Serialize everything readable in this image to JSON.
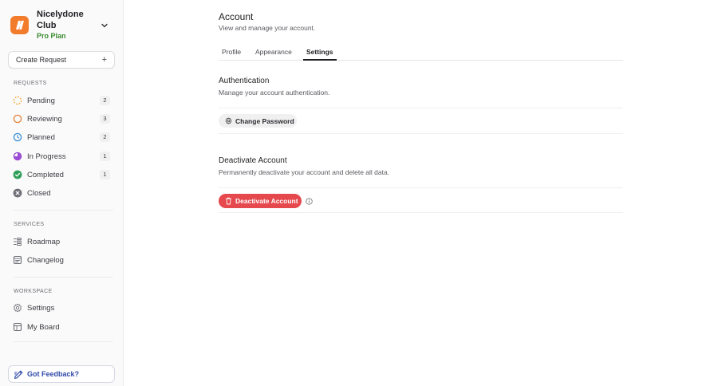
{
  "org": {
    "name": "Nicelydone Club",
    "plan": "Pro Plan"
  },
  "sidebar": {
    "create_label": "Create Request",
    "sections": {
      "requests": "REQUESTS",
      "services": "SERVICES",
      "workspace": "WORKSPACE"
    },
    "requests": [
      {
        "label": "Pending",
        "count": "2",
        "icon": "pending-dashed-circle-icon",
        "color": "#f2a93b"
      },
      {
        "label": "Reviewing",
        "count": "3",
        "icon": "reviewing-circle-icon",
        "color": "#e8833a"
      },
      {
        "label": "Planned",
        "count": "2",
        "icon": "planned-clock-icon",
        "color": "#3b8fd9"
      },
      {
        "label": "In Progress",
        "count": "1",
        "icon": "in-progress-icon",
        "color": "#9b4bd6"
      },
      {
        "label": "Completed",
        "count": "1",
        "icon": "completed-check-icon",
        "color": "#2f9e58"
      },
      {
        "label": "Closed",
        "icon": "closed-x-icon",
        "color": "#6f7077"
      }
    ],
    "services": [
      {
        "label": "Roadmap",
        "icon": "roadmap-icon"
      },
      {
        "label": "Changelog",
        "icon": "changelog-icon"
      }
    ],
    "workspace": [
      {
        "label": "Settings",
        "icon": "gear-icon"
      },
      {
        "label": "My Board",
        "icon": "board-icon"
      }
    ],
    "feedback_label": "Got Feedback?"
  },
  "main": {
    "title": "Account",
    "subtitle": "View and manage your account.",
    "tabs": [
      {
        "label": "Profile",
        "active": false
      },
      {
        "label": "Appearance",
        "active": false
      },
      {
        "label": "Settings",
        "active": true
      }
    ],
    "authentication": {
      "title": "Authentication",
      "description": "Manage your account authentication.",
      "button_label": "Change Password"
    },
    "deactivate": {
      "title": "Deactivate Account",
      "description": "Permanently deactivate your account and delete all data.",
      "button_label": "Deactivate Account"
    }
  },
  "colors": {
    "accent_orange": "#f27c2c",
    "plan_green": "#3a8a2f",
    "danger": "#e5484d"
  }
}
